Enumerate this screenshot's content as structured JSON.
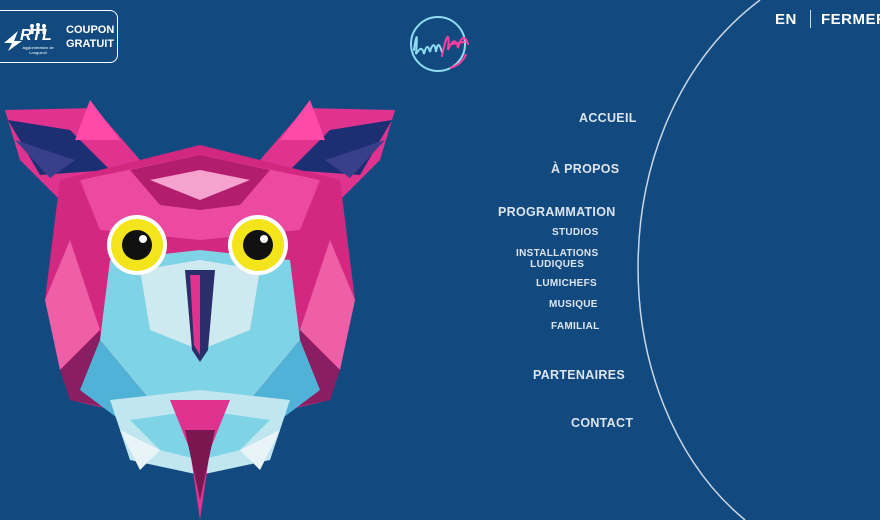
{
  "coupon": {
    "brand": "RTL",
    "brand_sub": "Agglomération de Longueuil",
    "line1": "COUPON",
    "line2": "GRATUIT"
  },
  "logo": {
    "name": "lumifest-logo-icon"
  },
  "header": {
    "lang": "EN",
    "close": "FERMER"
  },
  "menu": {
    "accueil": "ACCUEIL",
    "apropos": "À PROPOS",
    "programmation": "PROGRAMMATION",
    "studios": "STUDIOS",
    "installations_1": "INSTALLATIONS",
    "installations_2": "LUDIQUES",
    "lumichefs": "LUMICHEFS",
    "musique": "MUSIQUE",
    "familial": "FAMILIAL",
    "partenaires": "PARTENAIRES",
    "contact": "CONTACT"
  },
  "colors": {
    "background": "#124a80",
    "magenta": "#e0338f",
    "cyan": "#7fd3e6",
    "yellow": "#f4e41c"
  }
}
